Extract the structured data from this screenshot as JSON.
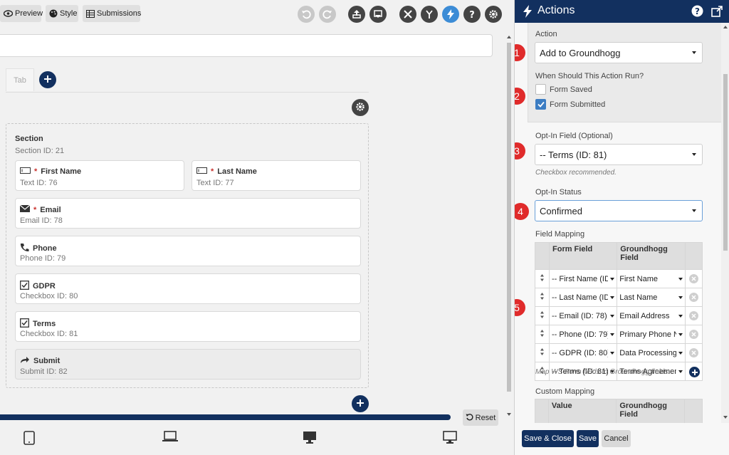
{
  "toolbar": {
    "preview_label": "Preview",
    "style_label": "Style",
    "submissions_label": "Submissions"
  },
  "tabs": [
    {
      "label": "Tab"
    }
  ],
  "section": {
    "title": "Section",
    "id_label": "Section  ID: 21"
  },
  "fields": [
    {
      "name": "First Name",
      "required": "*",
      "id_label": "Text  ID: 76",
      "icon": "text-field-icon"
    },
    {
      "name": "Last Name",
      "required": "*",
      "id_label": "Text  ID: 77",
      "icon": "text-field-icon"
    },
    {
      "name": "Email",
      "required": "*",
      "id_label": "Email  ID: 78",
      "icon": "envelope-icon"
    },
    {
      "name": "Phone",
      "id_label": "Phone  ID: 79",
      "icon": "phone-icon"
    },
    {
      "name": "GDPR",
      "id_label": "Checkbox  ID: 80",
      "icon": "checkbox-icon"
    },
    {
      "name": "Terms",
      "id_label": "Checkbox  ID: 81",
      "icon": "checkbox-icon"
    },
    {
      "name": "Submit",
      "id_label": "Submit  ID: 82",
      "icon": "submit-arrow-icon"
    }
  ],
  "reset_label": "Reset",
  "panel": {
    "title": "Actions",
    "action_label": "Action",
    "action_value": "Add to Groundhogg",
    "when_label": "When Should This Action Run?",
    "form_saved_label": "Form Saved",
    "form_submitted_label": "Form Submitted",
    "optin_field_label": "Opt-In Field (Optional)",
    "optin_field_value": "-- Terms (ID: 81)",
    "optin_field_help": "Checkbox recommended.",
    "optin_status_label": "Opt-In Status",
    "optin_status_value": "Confirmed",
    "field_mapping_label": "Field Mapping",
    "mapping_headers": {
      "form_field": "Form Field",
      "gh_field_1": "Groundhogg",
      "gh_field_2": "Field"
    },
    "mapping_rows": [
      {
        "form_field": "-- First Name (ID:",
        "gh_field": "First Name"
      },
      {
        "form_field": "-- Last Name (ID:",
        "gh_field": "Last Name"
      },
      {
        "form_field": "-- Email (ID: 78)",
        "gh_field": "Email Address"
      },
      {
        "form_field": "-- Phone (ID: 79)",
        "gh_field": "Primary Phone Nu"
      },
      {
        "form_field": "-- GDPR (ID: 80)",
        "gh_field": "Data Processing C"
      },
      {
        "form_field": "-- Terms (ID: 81)",
        "gh_field": "Terms Agreement"
      }
    ],
    "mapping_help": "Map WS Form fields to Groundhogg fields.",
    "custom_mapping_label": "Custom Mapping",
    "custom_headers": {
      "value": "Value",
      "gh_field_1": "Groundhogg",
      "gh_field_2": "Field"
    },
    "badges": [
      "1",
      "2",
      "3",
      "4",
      "5"
    ]
  },
  "footer": {
    "save_close_label": "Save & Close",
    "save_label": "Save",
    "cancel_label": "Cancel"
  },
  "colors": {
    "navy": "#12305f",
    "badge_red": "#e02b2b",
    "accent_blue": "#3c8cd6"
  }
}
